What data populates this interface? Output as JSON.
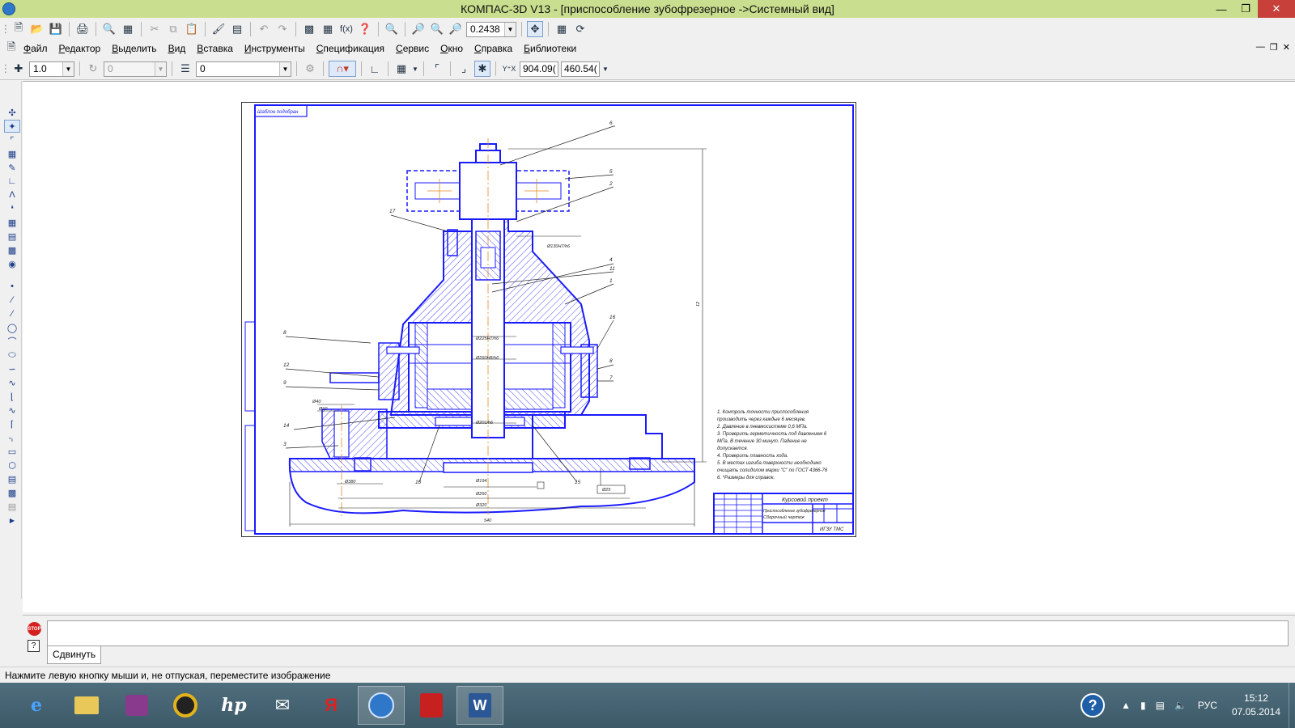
{
  "window": {
    "title": "КОМПАС-3D V13 - [приспособление зубофрезерное ->Системный вид]"
  },
  "menu": [
    "Файл",
    "Редактор",
    "Выделить",
    "Вид",
    "Вставка",
    "Инструменты",
    "Спецификация",
    "Сервис",
    "Окно",
    "Справка",
    "Библиотеки"
  ],
  "toolbar": {
    "zoom": "0.2438"
  },
  "props": {
    "step": "1.0",
    "angle": "0",
    "layer": "0",
    "coord_x": "904.09(",
    "coord_y": "460.54("
  },
  "drawing": {
    "stamp_top": "Шаблон подобран",
    "title_project": "Курсовой проект",
    "title_name1": "Приспособление зубофрезерное",
    "title_name2": "Сборочный чертеж",
    "title_org": "ИГЗУ ТМС",
    "tech_notes": [
      "1. Контроль точности приспособления",
      "производить через каждые 6 месяцев.",
      "2. Давление в пневмосистеме 0,6 МПа.",
      "3. Проверить герметичность под давлением 6",
      "МПа. В течение 30 минут. Падение не",
      "допускается.",
      "4. Проверить плавность хода.",
      "5. В местах изгиба поверхности необходимо",
      "очищать солидолом марки \"С\" по ГОСТ 4366-76",
      "6. *Размеры для справок."
    ],
    "leader_numbers": [
      "6",
      "5",
      "2",
      "17",
      "4",
      "11",
      "1",
      "16",
      "8",
      "7",
      "8",
      "12",
      "9",
      "14",
      "3",
      "10",
      "15"
    ],
    "dims": [
      "Ø130Н7/h6",
      "Ø225Н7/h6",
      "Ø260Н8/h6",
      "Ø201/h6",
      "Ø194",
      "Ø260",
      "Ø320",
      "Ø380",
      "540",
      "Ø40",
      "Ø10",
      "Ø25",
      "12"
    ]
  },
  "command": {
    "tab_label": "Сдвинуть"
  },
  "status": {
    "text": "Нажмите левую кнопку мыши и, не отпуская, переместите изображение"
  },
  "taskbar": {
    "language": "РУС",
    "time": "15:12",
    "date": "07.05.2014"
  }
}
